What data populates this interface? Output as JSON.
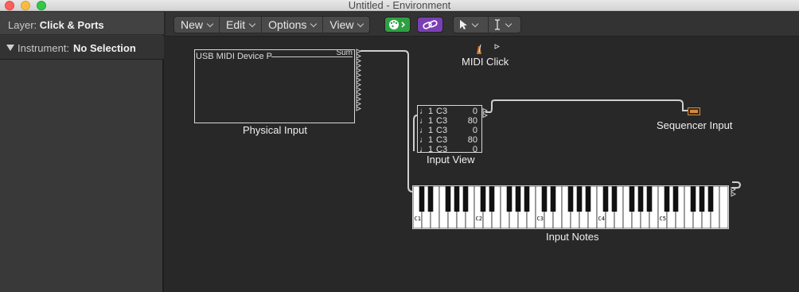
{
  "window": {
    "title": "Untitled - Environment"
  },
  "inspector": {
    "layer_label": "Layer: ",
    "layer_value": "Click & Ports",
    "instrument_label": "Instrument:",
    "instrument_value": "No Selection"
  },
  "toolbar": {
    "menus": [
      "New",
      "Edit",
      "Options",
      "View"
    ],
    "midi_thru_icon": "palette-icon",
    "link_icon": "link-icon",
    "pointer_tool_icon": "pointer-icon",
    "text_tool_icon": "text-cursor-icon",
    "colors": {
      "midi_button": "#2ea043",
      "link_button": "#7b3fb5"
    }
  },
  "objects": {
    "physical_input": {
      "label": "Physical Input",
      "device": "USB MIDI Device P",
      "sum": "Sum"
    },
    "midi_click": {
      "label": "MIDI Click"
    },
    "sequencer_input": {
      "label": "Sequencer Input"
    },
    "input_view": {
      "label": "Input View",
      "rows": [
        {
          "ch": "1",
          "note": "C3",
          "value": "0"
        },
        {
          "ch": "1",
          "note": "C3",
          "value": "80"
        },
        {
          "ch": "1",
          "note": "C3",
          "value": "0"
        },
        {
          "ch": "1",
          "note": "C3",
          "value": "80"
        },
        {
          "ch": "1",
          "note": "C3",
          "value": "0"
        }
      ]
    },
    "input_notes": {
      "label": "Input Notes",
      "octave_labels": [
        "C1",
        "C2",
        "C3",
        "C4",
        "C5"
      ]
    }
  }
}
